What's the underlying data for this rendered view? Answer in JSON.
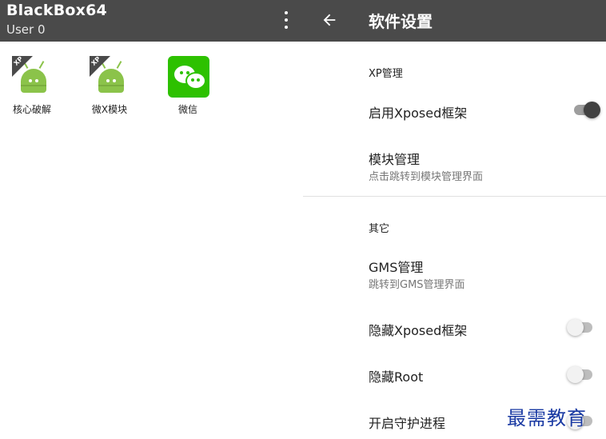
{
  "left": {
    "title": "BlackBox64",
    "subtitle": "User 0",
    "apps": [
      {
        "label": "核心破解",
        "badge": "XP",
        "icon": "android-icon"
      },
      {
        "label": "微X模块",
        "badge": "XP",
        "icon": "android-icon"
      },
      {
        "label": "微信",
        "icon": "wechat-icon"
      }
    ]
  },
  "right": {
    "title": "软件设置",
    "sections": [
      {
        "header": "XP管理",
        "items": [
          {
            "title": "启用Xposed框架",
            "toggle": true
          },
          {
            "title": "模块管理",
            "subtitle": "点击跳转到模块管理界面"
          }
        ]
      },
      {
        "header": "其它",
        "items": [
          {
            "title": "GMS管理",
            "subtitle": "跳转到GMS管理界面"
          },
          {
            "title": "隐藏Xposed框架",
            "toggle": false
          },
          {
            "title": "隐藏Root",
            "toggle": false
          },
          {
            "title": "开启守护进程",
            "toggle": false
          }
        ]
      }
    ]
  },
  "watermark": "最需教育",
  "colors": {
    "appbar": "#4a4a4a",
    "android": "#8bc34a",
    "wechat": "#2dc100",
    "watermark": "#1a3aa3"
  }
}
